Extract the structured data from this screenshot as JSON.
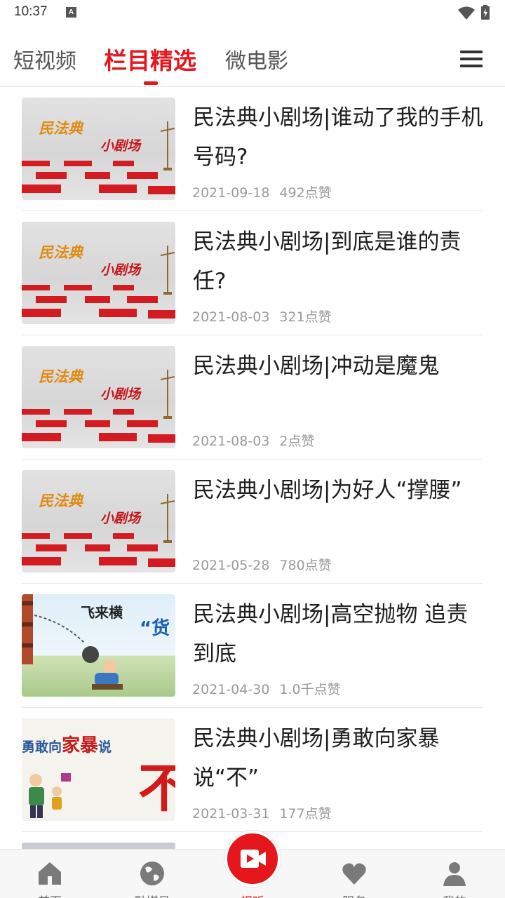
{
  "status_bar": {
    "time": "10:37",
    "notification_badge": "A"
  },
  "tabs": [
    {
      "label": "短视频",
      "active": false
    },
    {
      "label": "栏目精选",
      "active": true
    },
    {
      "label": "微电影",
      "active": false
    }
  ],
  "accent_color": "#e5161c",
  "items": [
    {
      "title": "民法典小剧场|谁动了我的手机号码?",
      "date": "2021-09-18",
      "likes": "492点赞",
      "thumb": "legal",
      "thumb_text": [
        "民法典",
        "小剧场"
      ]
    },
    {
      "title": "民法典小剧场|到底是谁的责任?",
      "date": "2021-08-03",
      "likes": "321点赞",
      "thumb": "legal",
      "thumb_text": [
        "民法典",
        "小剧场"
      ]
    },
    {
      "title": "民法典小剧场|冲动是魔鬼",
      "date": "2021-08-03",
      "likes": "2点赞",
      "thumb": "legal",
      "thumb_text": [
        "民法典",
        "小剧场"
      ]
    },
    {
      "title": "民法典小剧场|为好人“撑腰”",
      "date": "2021-05-28",
      "likes": "780点赞",
      "thumb": "legal",
      "thumb_text": [
        "民法典",
        "小剧场"
      ]
    },
    {
      "title": "民法典小剧场|高空抛物 追责到底",
      "date": "2021-04-30",
      "likes": "1.0千点赞",
      "thumb": "cartoon1",
      "thumb_text": [
        "飞来横",
        "“货"
      ]
    },
    {
      "title": "民法典小剧场|勇敢向家暴说“不”",
      "date": "2021-03-31",
      "likes": "177点赞",
      "thumb": "cartoon2",
      "thumb_text": [
        "勇敢向",
        "家暴",
        "说",
        "不"
      ]
    }
  ],
  "bottom_nav": [
    {
      "label": "首页",
      "icon": "home-icon",
      "active": false
    },
    {
      "label": "融媒号",
      "icon": "globe-icon",
      "active": false
    },
    {
      "label": "视听",
      "icon": "video-play-icon",
      "active": true
    },
    {
      "label": "服务",
      "icon": "heart-icon",
      "active": false
    },
    {
      "label": "我的",
      "icon": "user-icon",
      "active": false
    }
  ]
}
